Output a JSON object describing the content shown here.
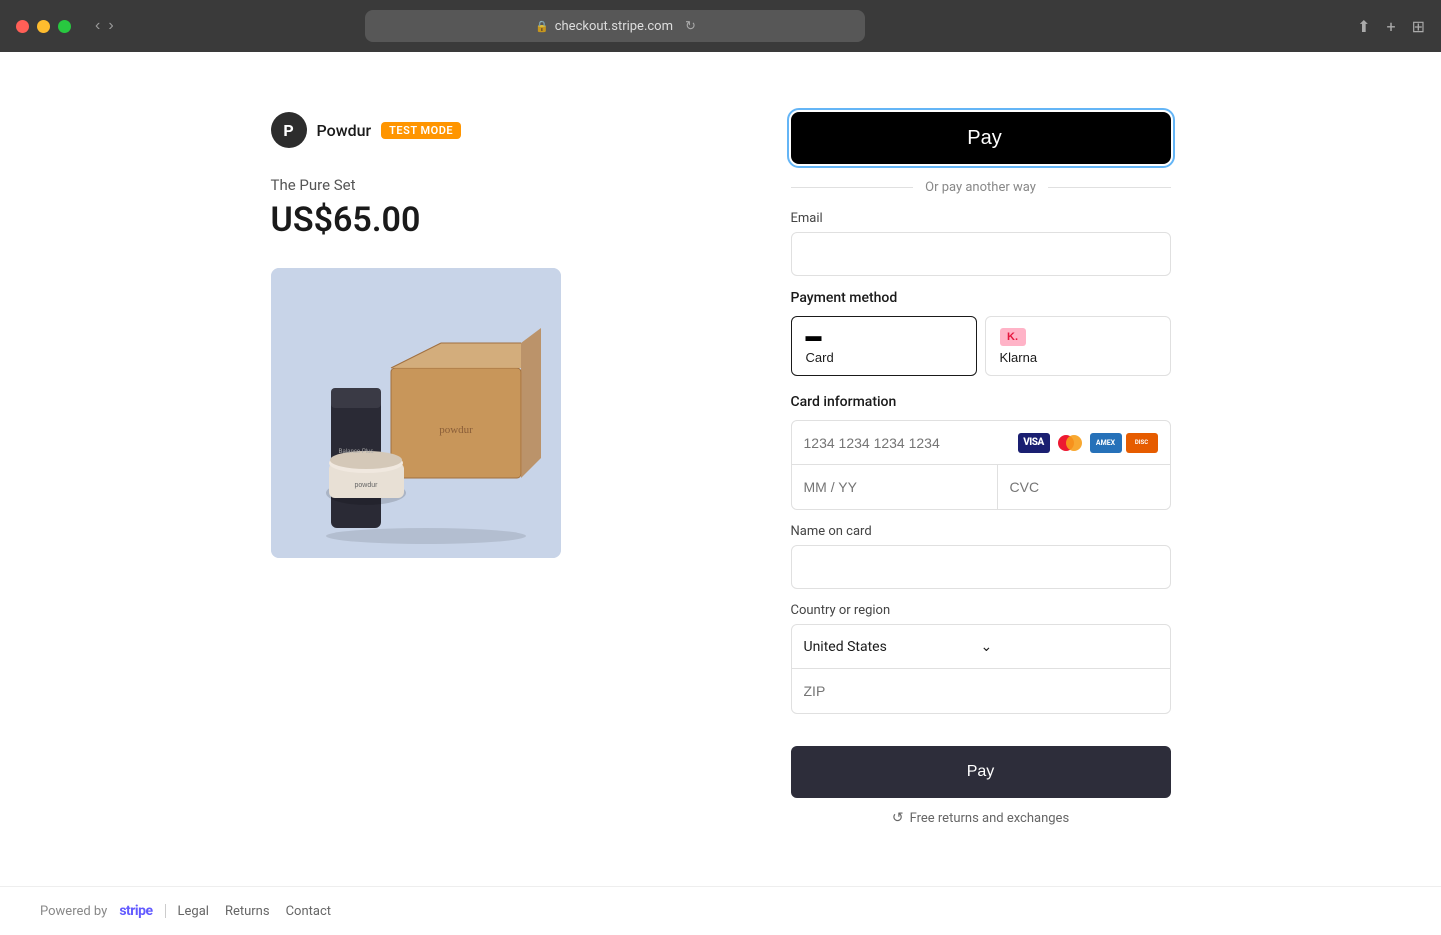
{
  "browser": {
    "url": "checkout.stripe.com"
  },
  "brand": {
    "logo_letter": "P",
    "name": "Powdur",
    "test_mode_label": "TEST MODE"
  },
  "product": {
    "name": "The Pure Set",
    "price": "US$65.00"
  },
  "apple_pay": {
    "label": "Pay"
  },
  "divider": {
    "text": "Or pay another way"
  },
  "form": {
    "email_label": "Email",
    "email_placeholder": "",
    "payment_method_label": "Payment method",
    "payment_methods": [
      {
        "id": "card",
        "label": "Card",
        "icon": "card"
      },
      {
        "id": "klarna",
        "label": "Klarna",
        "icon": "klarna"
      }
    ],
    "card_info_label": "Card information",
    "card_number_placeholder": "1234 1234 1234 1234",
    "expiry_placeholder": "MM / YY",
    "cvc_placeholder": "CVC",
    "name_label": "Name on card",
    "name_placeholder": "",
    "country_label": "Country or region",
    "country_value": "United States",
    "zip_placeholder": "ZIP"
  },
  "pay_button": {
    "label": "Pay"
  },
  "free_returns": {
    "text": "Free returns and exchanges"
  },
  "footer": {
    "powered_by": "Powered by",
    "stripe": "stripe",
    "links": [
      {
        "label": "Legal"
      },
      {
        "label": "Returns"
      },
      {
        "label": "Contact"
      }
    ]
  }
}
